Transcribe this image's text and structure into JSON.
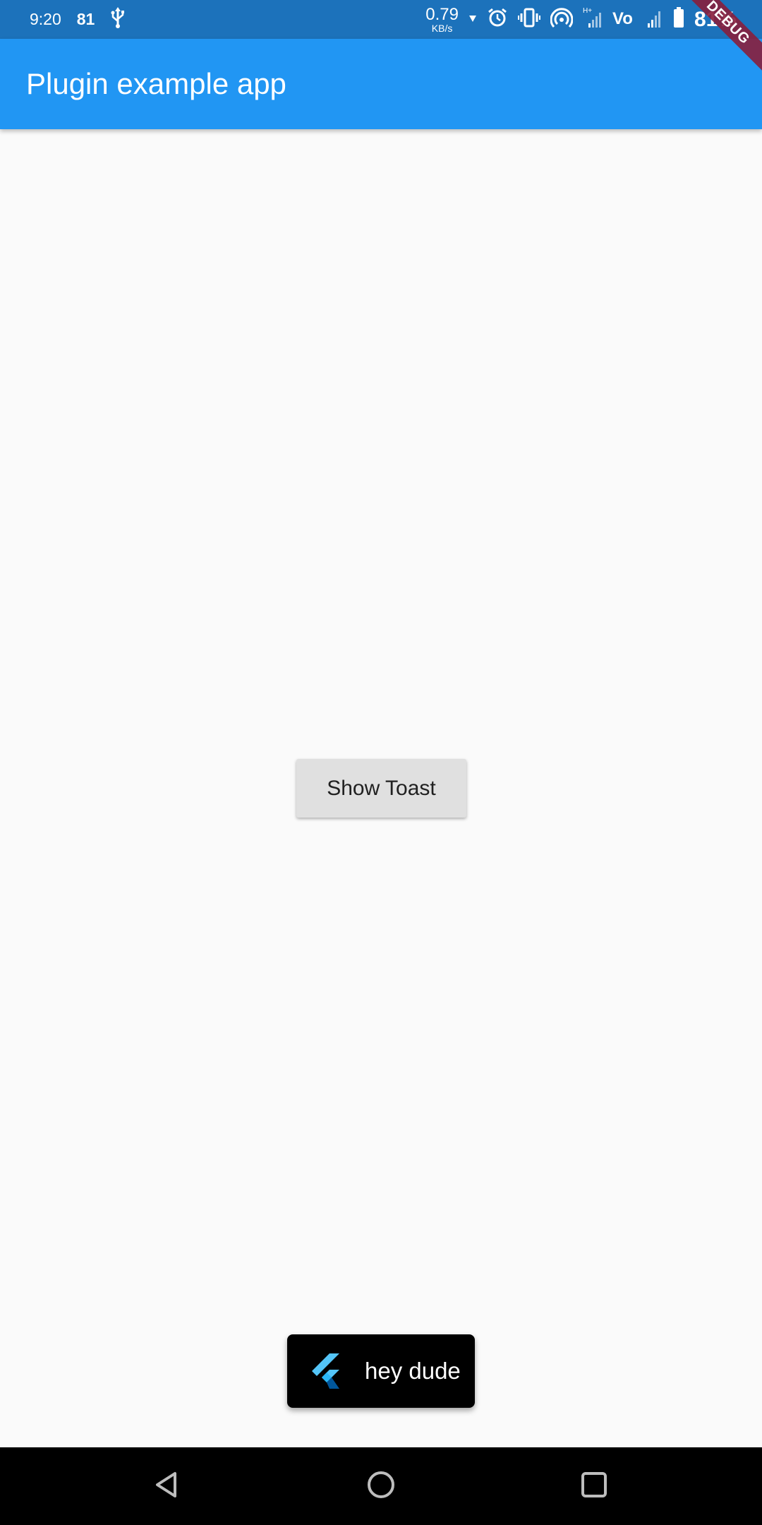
{
  "status_bar": {
    "time": "9:20",
    "notification_count": "81",
    "usb_icon": "usb-icon",
    "net_speed_value": "0.79",
    "net_speed_unit": "KB/s",
    "battery_percent": "81%",
    "background_color": "#1c72bb"
  },
  "app_bar": {
    "title": "Plugin example app",
    "background_color": "#2196f3"
  },
  "debug_banner": {
    "label": "DEBUG"
  },
  "main": {
    "show_toast_label": "Show Toast"
  },
  "toast": {
    "icon": "flutter-logo-icon",
    "message": "hey dude"
  },
  "nav_bar": {
    "back_icon": "back-icon",
    "home_icon": "home-icon",
    "recents_icon": "recents-icon"
  }
}
